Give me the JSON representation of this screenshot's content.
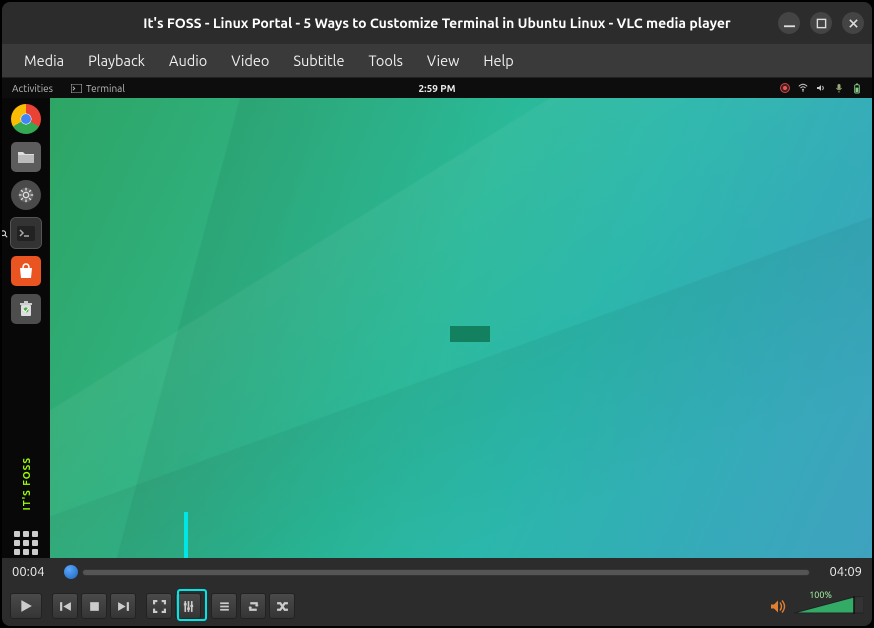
{
  "window": {
    "title": "It's FOSS - Linux Portal - 5 Ways to Customize Terminal in Ubuntu Linux - VLC media player"
  },
  "menu": {
    "items": [
      "Media",
      "Playback",
      "Audio",
      "Video",
      "Subtitle",
      "Tools",
      "View",
      "Help"
    ]
  },
  "video_content": {
    "topbar": {
      "activities": "Activities",
      "app": "Terminal",
      "clock": "2:59 PM"
    },
    "watermark": "IT'S FOSS"
  },
  "timeline": {
    "current": "00:04",
    "total": "04:09"
  },
  "volume": {
    "percent": "100%",
    "value": 100
  },
  "icons": {
    "minimize": "minimize",
    "maximize": "maximize",
    "close": "close",
    "speaker": "speaker"
  }
}
